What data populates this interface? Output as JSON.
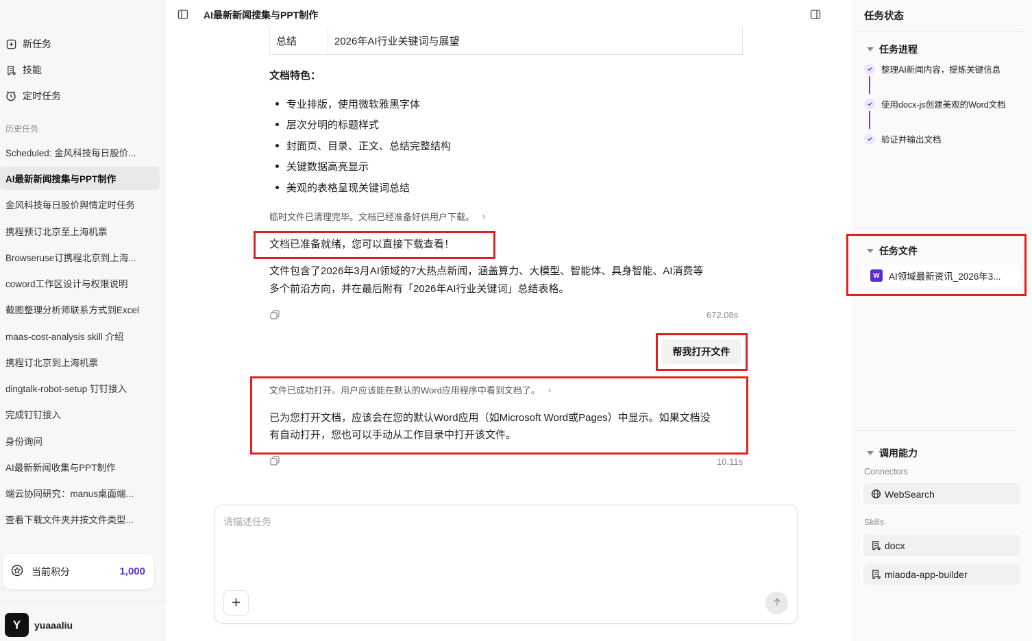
{
  "sidebar": {
    "nav": [
      {
        "label": "新任务",
        "icon": "plus-square-icon"
      },
      {
        "label": "技能",
        "icon": "scroll-icon"
      },
      {
        "label": "定时任务",
        "icon": "clock-icon"
      }
    ],
    "history_label": "历史任务",
    "history": [
      "Scheduled: 金风科技每日股价...",
      "AI最新新闻搜集与PPT制作",
      "金风科技每日股价舆情定时任务",
      "携程预订北京至上海机票",
      "Browseruse订携程北京到上海...",
      "coword工作区设计与权限说明",
      "截图整理分析师联系方式到Excel",
      "maas-cost-analysis skill 介绍",
      "携程订北京到上海机票",
      "dingtalk-robot-setup 钉钉接入",
      "完成钉钉接入",
      "身份询问",
      "AI最新新闻收集与PPT制作",
      "端云协同研究：manus桌面端...",
      "查看下载文件夹并按文件类型..."
    ],
    "active_index": 1,
    "points": {
      "label": "当前积分",
      "value": "1,000"
    },
    "user": {
      "avatar": "Y",
      "name": "yuaaaliu"
    }
  },
  "main": {
    "title": "AI最新新闻搜集与PPT制作",
    "table_row": {
      "key": "总结",
      "value": "2026年AI行业关键词与展望"
    },
    "features_title": "文档特色：",
    "features": [
      "专业排版，使用微软雅黑字体",
      "层次分明的标题样式",
      "封面页、目录、正文、总结完整结构",
      "关键数据高亮显示",
      "美观的表格呈现关键词总结"
    ],
    "tool1": "临时文件已清理完毕。文档已经准备好供用户下载。",
    "ready_text": "文档已准备就绪，您可以直接下载查看！",
    "desc_line1": "文件包含了2026年3月AI领域的7大热点新闻，涵盖算力、大模型、智能体、具身智能、AI消费等",
    "desc_line2": "多个前沿方向，并在最后附有「2026年AI行业关键词」总结表格。",
    "duration1": "672.08s",
    "user_message": "帮我打开文件",
    "tool2": "文件已成功打开。用户应该能在默认的Word应用程序中看到文档了。",
    "reply_line1": "已为您打开文档，应该会在您的默认Word应用（如Microsoft Word或Pages）中显示。如果文档没",
    "reply_line2": "有自动打开，您也可以手动从工作目录中打开该文件。",
    "duration2": "10.11s",
    "composer_placeholder": "请描述任务"
  },
  "right": {
    "title": "任务状态",
    "progress_title": "任务进程",
    "steps": [
      "整理AI新闻内容，提炼关键信息",
      "使用docx-js创建美观的Word文档",
      "验证并输出文档"
    ],
    "files_title": "任务文件",
    "file_name": "AI领域最新资讯_2026年3...",
    "file_icon_letter": "W",
    "capabilities_title": "调用能力",
    "connectors_label": "Connectors",
    "connectors": [
      "WebSearch"
    ],
    "skills_label": "Skills",
    "skills": [
      "docx",
      "miaoda-app-builder"
    ]
  },
  "colors": {
    "accent": "#5b2bd6",
    "highlight_box": "#e02020"
  }
}
